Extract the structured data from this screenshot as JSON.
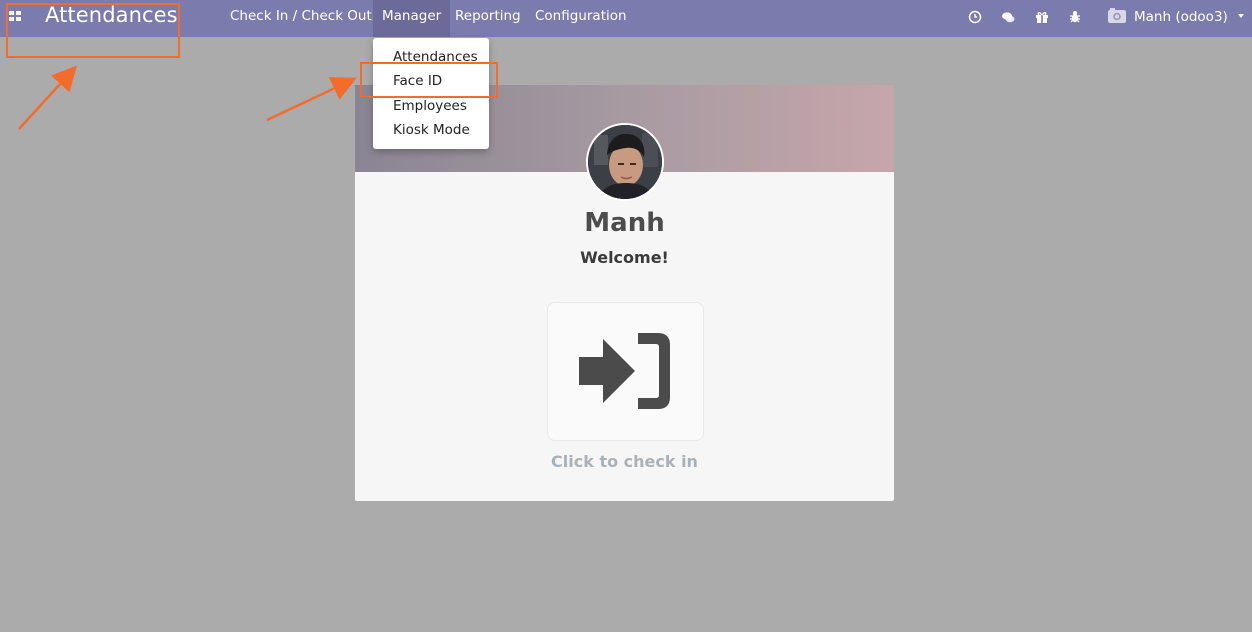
{
  "topbar": {
    "app_title": "Attendances",
    "menu": [
      {
        "label": "Check In / Check Out"
      },
      {
        "label": "Manager"
      },
      {
        "label": "Reporting"
      },
      {
        "label": "Configuration"
      }
    ],
    "system_icons": [
      "clock-icon",
      "chat-icon",
      "gift-icon",
      "bug-icon"
    ],
    "user_label": "Manh (odoo3)"
  },
  "dropdown": {
    "items": [
      {
        "label": "Attendances"
      },
      {
        "label": "Face ID"
      },
      {
        "label": "Employees"
      },
      {
        "label": "Kiosk Mode"
      }
    ]
  },
  "card": {
    "employee_name": "Manh",
    "greeting": "Welcome!",
    "checkin_label": "Click to check in"
  },
  "colors": {
    "topbar": "#7c7bad",
    "background": "#ababab",
    "annotation": "#f36c2b"
  }
}
